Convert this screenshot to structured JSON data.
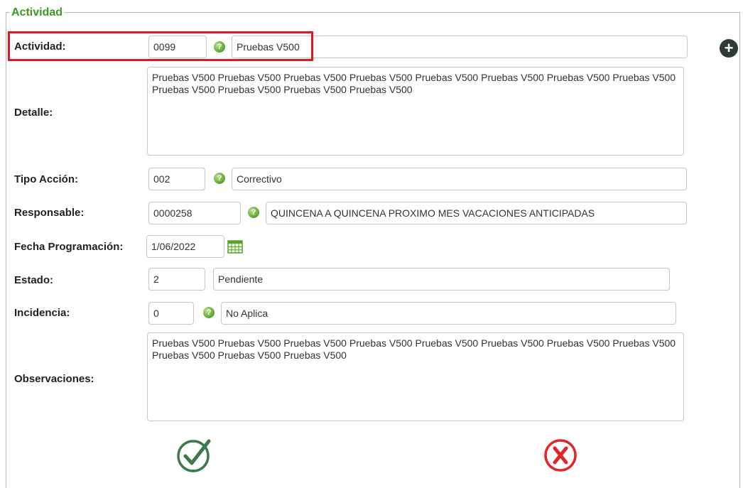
{
  "section": {
    "title": "Actividad"
  },
  "fields": {
    "actividad": {
      "label": "Actividad:",
      "code": "0099",
      "desc": "Pruebas V500"
    },
    "detalle": {
      "label": "Detalle:",
      "text": "Pruebas V500 Pruebas V500 Pruebas V500 Pruebas V500 Pruebas V500 Pruebas V500 Pruebas V500 Pruebas V500 Pruebas V500 Pruebas V500 Pruebas V500 Pruebas V500"
    },
    "tipo_accion": {
      "label": "Tipo Acción:",
      "code": "002",
      "desc": "Correctivo"
    },
    "responsable": {
      "label": "Responsable:",
      "code": "0000258",
      "desc": "QUINCENA A QUINCENA PROXIMO MES VACACIONES ANTICIPADAS"
    },
    "fecha": {
      "label": "Fecha Programación:",
      "value": "1/06/2022"
    },
    "estado": {
      "label": "Estado:",
      "code": "2",
      "desc": "Pendiente"
    },
    "incidencia": {
      "label": "Incidencia:",
      "code": "0",
      "desc": "No Aplica"
    },
    "observaciones": {
      "label": "Observaciones:",
      "text": "Pruebas V500 Pruebas V500 Pruebas V500 Pruebas V500 Pruebas V500 Pruebas V500 Pruebas V500 Pruebas V500 Pruebas V500 Pruebas V500 Pruebas V500"
    }
  },
  "icons": {
    "help": "help-icon",
    "add": "add-circle-icon",
    "calendar": "calendar-icon",
    "confirm": "check-circle-icon",
    "cancel": "x-circle-icon"
  },
  "colors": {
    "section_title": "#3a9a22",
    "highlight": "#e8141e",
    "confirm": "#3b7a4a",
    "cancel": "#e0262b"
  }
}
